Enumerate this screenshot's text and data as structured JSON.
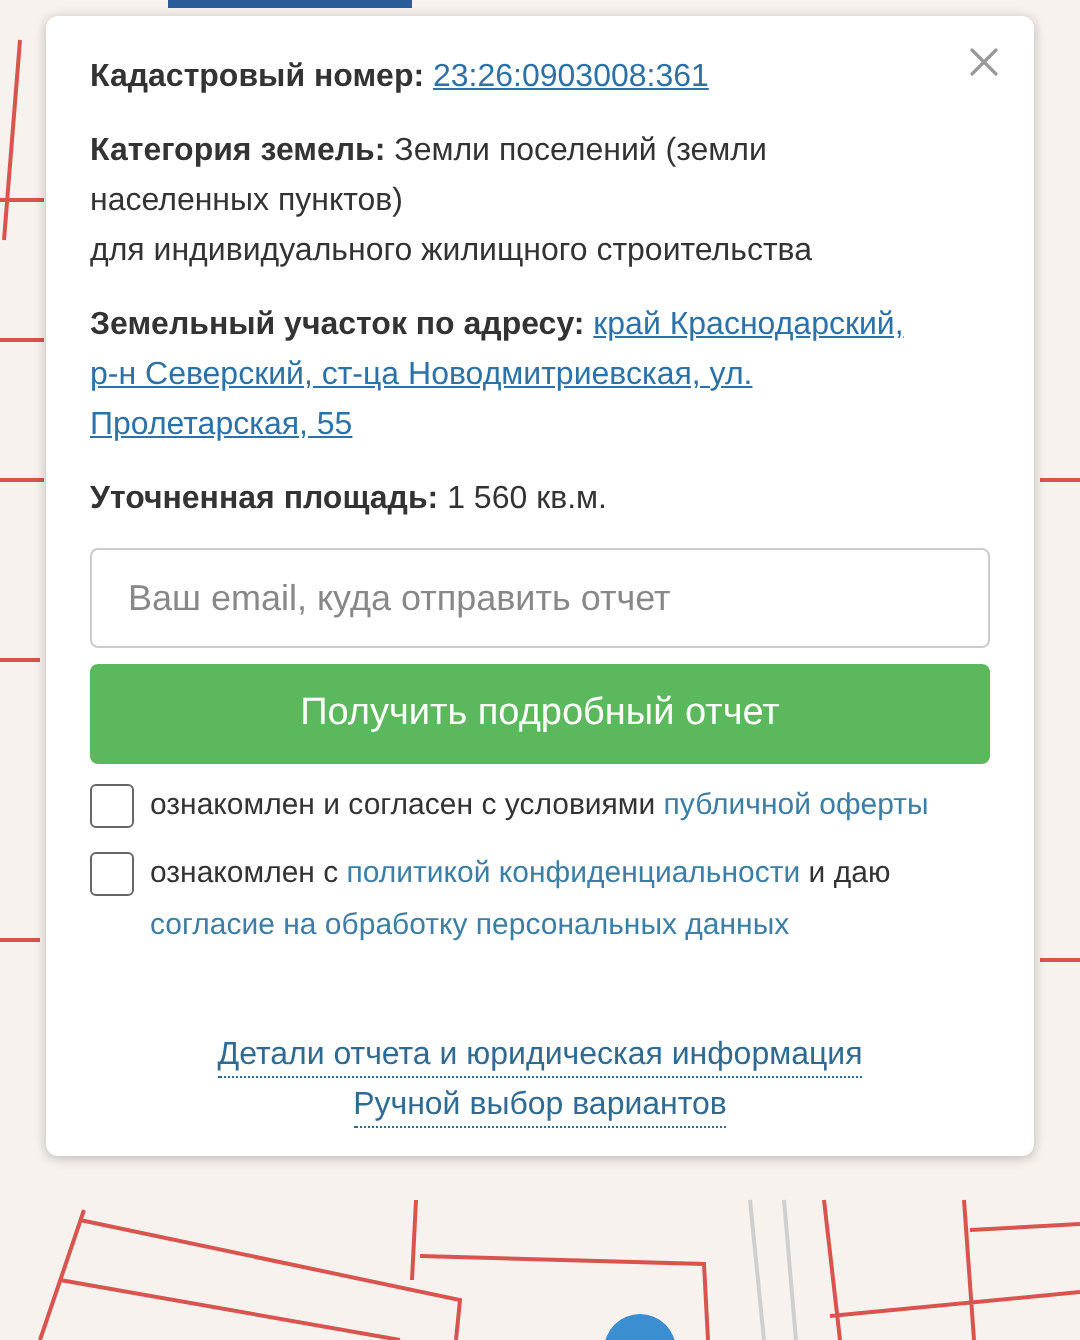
{
  "popup": {
    "fields": [
      {
        "label": "Кадастровый номер:",
        "kind": "link",
        "lines": [
          "23:26:0903008:361"
        ]
      },
      {
        "label": "Категория земель:",
        "kind": "text",
        "lines": [
          "Земли поселений (земли",
          "населенных пунктов)",
          "для индивидуального жилищного строительства"
        ]
      },
      {
        "label": "Земельный участок по адресу:",
        "kind": "link",
        "lines": [
          "край Краснодарский,",
          "р-н Северский, ст-ца Новодмитриевская, ул.",
          "Пролетарская, 55"
        ]
      },
      {
        "label": "Уточненная площадь:",
        "kind": "text",
        "lines": [
          "1 560 кв.м."
        ]
      }
    ],
    "email": {
      "placeholder": "Ваш email, куда отправить отчет"
    },
    "submit": "Получить подробный отчет",
    "consents": [
      {
        "checked": false,
        "parts": [
          {
            "text": "ознакомлен и согласен с условиями ",
            "kind": "text"
          },
          {
            "text": "публичной оферты",
            "kind": "link"
          }
        ]
      },
      {
        "checked": false,
        "parts": [
          {
            "text": "ознакомлен с ",
            "kind": "text"
          },
          {
            "text": "политикой конфиденциальности",
            "kind": "link"
          },
          {
            "text": " и даю ",
            "kind": "text"
          },
          {
            "text": "согласие на обработку персональных данных",
            "kind": "link"
          }
        ]
      }
    ],
    "footer_links": [
      "Детали отчета и юридическая информация",
      "Ручной выбор вариантов"
    ]
  }
}
